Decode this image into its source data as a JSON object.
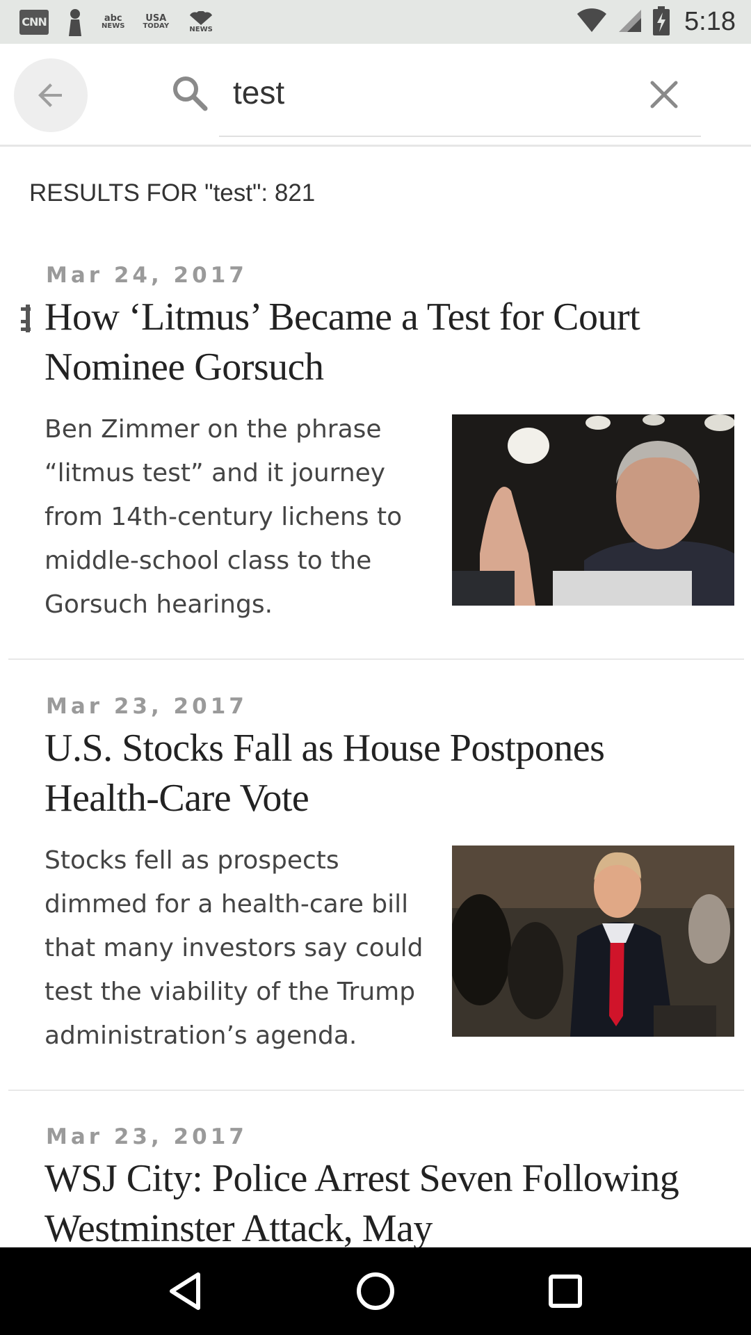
{
  "status_bar": {
    "time": "5:18",
    "notification_icons": [
      "cnn-icon",
      "person-icon",
      "abc-news-icon",
      "usa-today-icon",
      "nbc-news-icon"
    ],
    "cnn_label": "CNN",
    "abc_top": "abc",
    "abc_bottom": "NEWS",
    "usa_top": "USA",
    "usa_bottom": "TODAY",
    "nbc_bottom": "NEWS"
  },
  "search": {
    "query": "test"
  },
  "results": {
    "count_label": "RESULTS FOR \"test\": 821"
  },
  "articles": [
    {
      "date": "Mar 24, 2017",
      "title": "How ‘Litmus’ Became a Test for Court Nominee Gorsuch",
      "summary": "Ben Zimmer on the phrase “litmus test” and it journey from 14th-century lichens to middle-school class to the Gorsuch hearings.",
      "bookmarked": true
    },
    {
      "date": "Mar 23, 2017",
      "title": "U.S. Stocks Fall as House Postpones Health-Care Vote",
      "summary": "Stocks fell as prospects dimmed for a health-care bill that many investors say could test the viability of the Trump administration’s agenda."
    },
    {
      "date": "Mar 23, 2017",
      "title": "WSJ City: Police Arrest Seven Following Westminster Attack, May"
    }
  ],
  "colors": {
    "status_bar_bg": "#e4e7e4",
    "nav_bar_bg": "#000000",
    "title_text": "#222222",
    "date_text": "#9a9a9a"
  }
}
